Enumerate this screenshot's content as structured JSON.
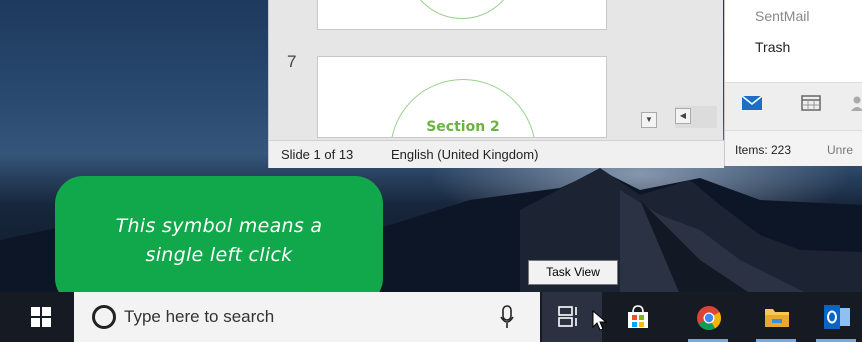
{
  "powerpoint": {
    "thumbnail_number": "7",
    "section_title": "Section 2",
    "status": {
      "slide_position": "Slide 1 of 13",
      "language": "English (United Kingdom)"
    }
  },
  "outlook": {
    "folders": [
      "SentMail",
      "Trash"
    ],
    "nav_icons": [
      "mail-icon",
      "calendar-icon",
      "people-icon"
    ],
    "status": {
      "items": "Items: 223",
      "unread": "Unre"
    }
  },
  "callout": {
    "line1": "This symbol means a",
    "line2": "single left click",
    "color": "#11a84b"
  },
  "tooltip": {
    "text": "Task View"
  },
  "taskbar": {
    "search_placeholder": "Type here to search",
    "icons": [
      "windows-logo-icon",
      "cortana-icon",
      "microphone-icon",
      "task-view-icon",
      "store-icon",
      "chrome-icon",
      "file-explorer-icon",
      "outlook-icon"
    ],
    "accent": "#76a9e0"
  }
}
